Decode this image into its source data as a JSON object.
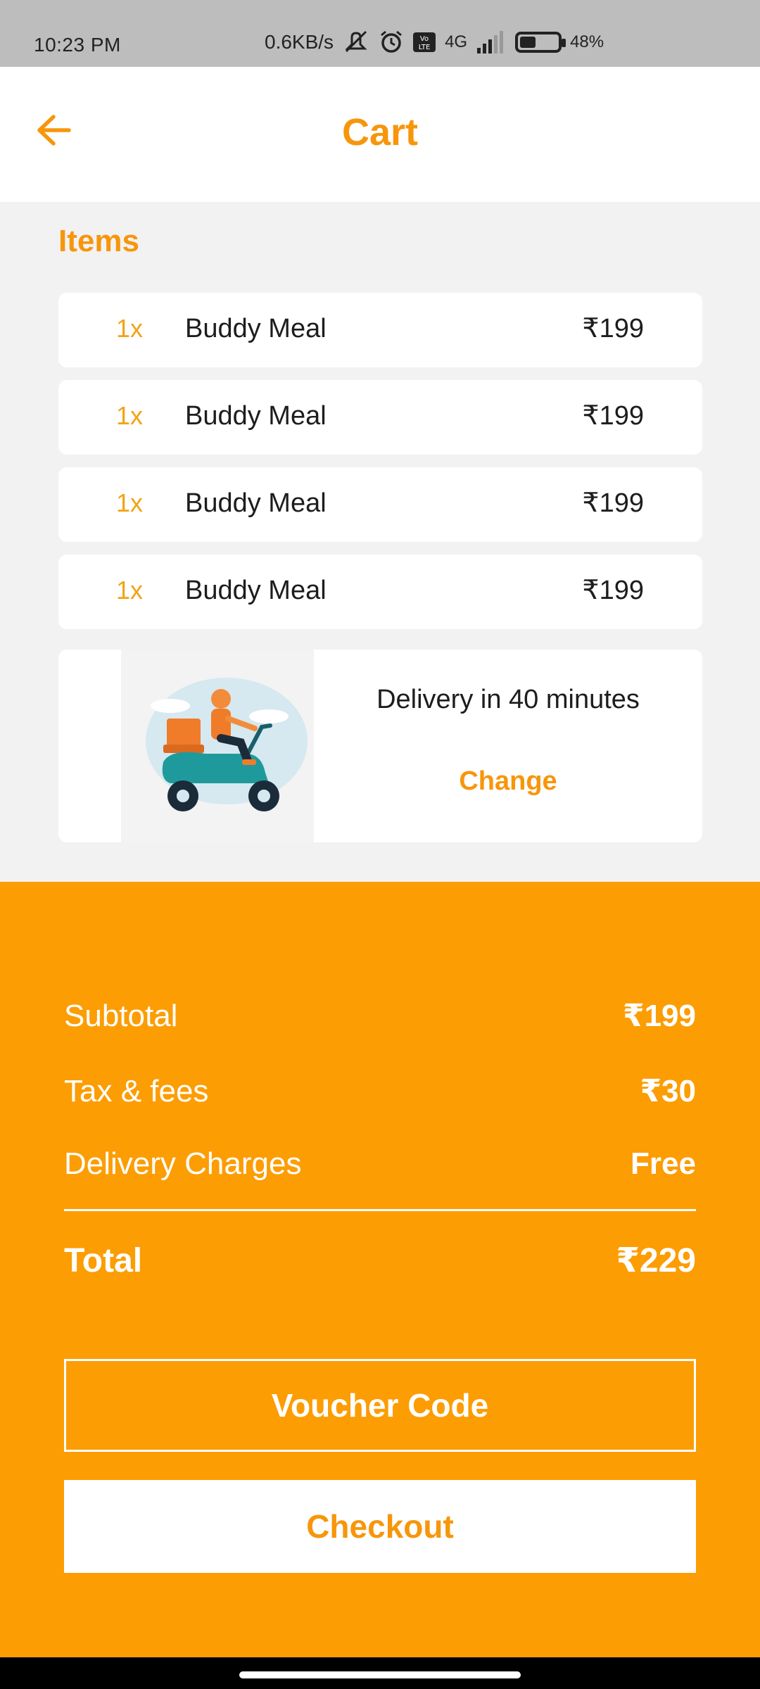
{
  "status_bar": {
    "time": "10:23 PM",
    "network_speed": "0.6KB/s",
    "network_type": "4G",
    "battery": "48%",
    "battery_level": 0.48
  },
  "header": {
    "title": "Cart",
    "back_icon": "arrow-left-icon"
  },
  "items_section": {
    "heading": "Items",
    "items": [
      {
        "qty": "1x",
        "name": "Buddy Meal",
        "price": "₹199"
      },
      {
        "qty": "1x",
        "name": "Buddy Meal",
        "price": "₹199"
      },
      {
        "qty": "1x",
        "name": "Buddy Meal",
        "price": "₹199"
      },
      {
        "qty": "1x",
        "name": "Buddy Meal",
        "price": "₹199"
      }
    ]
  },
  "delivery": {
    "text": "Delivery in 40 minutes",
    "change_label": "Change",
    "image": "scooter-delivery-illustration"
  },
  "summary": {
    "subtotal_label": "Subtotal",
    "subtotal_value": "₹199",
    "tax_label": "Tax & fees",
    "tax_value": "₹30",
    "delivery_label": "Delivery Charges",
    "delivery_value": "Free",
    "total_label": "Total",
    "total_value": "₹229"
  },
  "actions": {
    "voucher_label": "Voucher Code",
    "checkout_label": "Checkout"
  },
  "colors": {
    "accent": "#f7960b",
    "summary_bg": "#fc9d04",
    "qty": "#f2a316"
  }
}
